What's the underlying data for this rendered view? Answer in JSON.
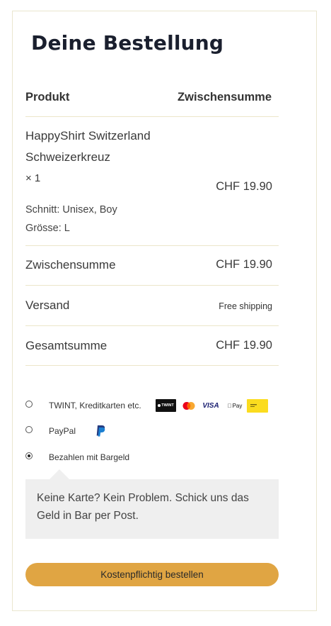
{
  "order": {
    "title": "Deine Bestellung",
    "col_product": "Produkt",
    "col_subtotal": "Zwischensumme",
    "item": {
      "name_line1": "HappyShirt Switzerland",
      "name_line2": "Schweizerkreuz",
      "qty": "× 1",
      "price": "CHF 19.90",
      "cut": "Schnitt: Unisex, Boy",
      "size": "Grösse: L"
    },
    "subtotal_label": "Zwischensumme",
    "subtotal_value": "CHF 19.90",
    "shipping_label": "Versand",
    "shipping_value": "Free shipping",
    "total_label": "Gesamtsumme",
    "total_value": "CHF 19.90"
  },
  "payment": {
    "methods": [
      {
        "label": "TWINT, Kreditkarten etc.",
        "selected": false,
        "logos": [
          "twint-logo",
          "mastercard-logo",
          "visa-logo",
          "apple-pay-logo",
          "postfinance-logo"
        ]
      },
      {
        "label": "PayPal",
        "selected": false,
        "logos": [
          "paypal-logo"
        ]
      },
      {
        "label": "Bezahlen mit Bargeld",
        "selected": true,
        "logos": []
      }
    ],
    "logo_text": {
      "twint": "TWINT",
      "visa": "VISA",
      "apple_pay": "Pay"
    },
    "cash_description": "Keine Karte? Kein Problem. Schick uns das Geld in Bar per Post."
  },
  "submit_label": "Kostenpflichtig bestellen",
  "colors": {
    "button": "#e0a543",
    "divider": "#ece6c9",
    "title": "#1a1f2e",
    "info_box": "#efefef",
    "postfinance": "#fbdc1f",
    "paypal_blue": "#1b7fd1"
  }
}
